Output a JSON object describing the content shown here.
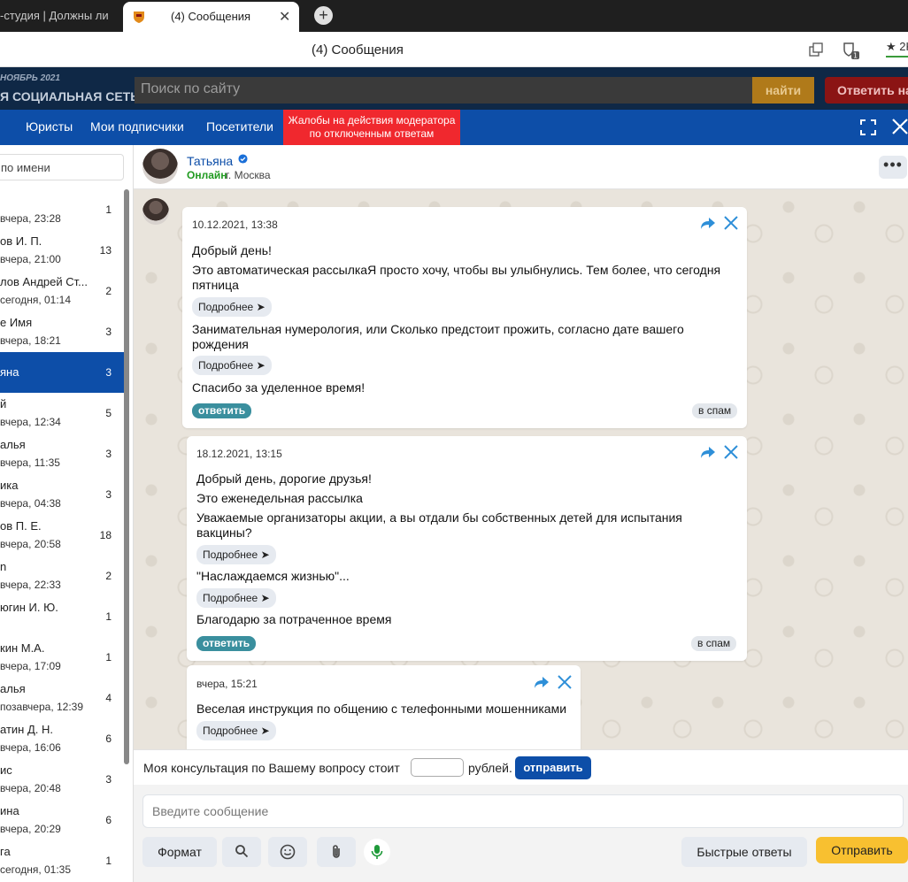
{
  "browser": {
    "tab1_title": "-студия | Должны ли",
    "tab_active_title": "(4) Сообщения",
    "page_title": "(4) Сообщения",
    "rating": "★ 2K"
  },
  "site": {
    "date_label": "НОЯБРЬ 2021",
    "slogan": "Я СОЦИАЛЬНАЯ СЕТЬ",
    "search_placeholder": "Поиск по сайту",
    "find_label": "найти",
    "answer_label": "Ответить на"
  },
  "nav": {
    "lawyers": "Юристы",
    "subscribers": "Мои подписчики",
    "visitors": "Посетители",
    "complaints": "Жалобы на действия модератора по отключенным ответам"
  },
  "contacts": {
    "search_placeholder": "по имени",
    "items": [
      {
        "name": "",
        "time": "вчера, 23:28",
        "count": "1"
      },
      {
        "name": "ов И. П.",
        "time": "вчера, 21:00",
        "count": "13"
      },
      {
        "name": "лов Андрей Ст...",
        "time": "сегодня, 01:14",
        "count": "2"
      },
      {
        "name": "е Имя",
        "time": "вчера, 18:21",
        "count": "3"
      },
      {
        "name": "яна",
        "time": "",
        "count": "3"
      },
      {
        "name": "й",
        "time": "вчера, 12:34",
        "count": "5"
      },
      {
        "name": "алья",
        "time": "вчера, 11:35",
        "count": "3"
      },
      {
        "name": "ика",
        "time": "вчера, 04:38",
        "count": "3"
      },
      {
        "name": "ов П. Е.",
        "time": "вчера, 20:58",
        "count": "18"
      },
      {
        "name": "n",
        "time": "вчера, 22:33",
        "count": "2"
      },
      {
        "name": "югин И. Ю.",
        "time": "",
        "count": "1"
      },
      {
        "name": "кин М.А.",
        "time": "вчера, 17:09",
        "count": "1"
      },
      {
        "name": "алья",
        "time": "позавчера, 12:39",
        "count": "4"
      },
      {
        "name": "атин Д. Н.",
        "time": "вчера, 16:06",
        "count": "6"
      },
      {
        "name": "ис",
        "time": "вчера, 20:48",
        "count": "3"
      },
      {
        "name": "ина",
        "time": "вчера, 20:29",
        "count": "6"
      },
      {
        "name": "га",
        "time": "сегодня, 01:35",
        "count": "1"
      }
    ]
  },
  "chat": {
    "user_name": "Татьяна",
    "online": "Онлайн",
    "city": "г. Москва",
    "more": "•••"
  },
  "messages": {
    "m1": {
      "date": "10.12.2021, 13:38",
      "l1": "Добрый день!",
      "l2": "Это автоматическая рассылкаЯ просто хочу, чтобы вы улыбнулись. Тем более, что сегодня пятница",
      "l3": "Занимательная нумерология, или Сколько предстоит прожить, согласно дате вашего рождения",
      "l4": "Спасибо за уделенное время!"
    },
    "m2": {
      "date": "18.12.2021, 13:15",
      "l1": "Добрый день, дорогие друзья!",
      "l2": "Это еженедельная рассылка",
      "l3": "Уважаемые организаторы акции, а вы отдали бы собственных детей для испытания вакцины?",
      "l4": "\"Наслаждаемся жизнью\"...",
      "l5": "Благодарю за потраченное время"
    },
    "m3": {
      "date": "вчера, 15:21",
      "l1": "Веселая инструкция по общению с телефонными мошенниками"
    },
    "more_label": "Подробнее ➤",
    "reply_label": "ответить",
    "spam_label": "в спам"
  },
  "consult": {
    "text": "Моя консультация по Вашему вопросу стоит",
    "currency": "рублей.",
    "send_label": "отправить"
  },
  "composer": {
    "placeholder": "Введите сообщение",
    "format_label": "Формат",
    "quick_label": "Быстрые ответы",
    "send_label": "Отправить"
  },
  "colors": {
    "brand_blue": "#0d4ea8",
    "complaint_red": "#f0282e",
    "send_yellow": "#f8c030",
    "reply_teal": "#3a8f9e"
  }
}
